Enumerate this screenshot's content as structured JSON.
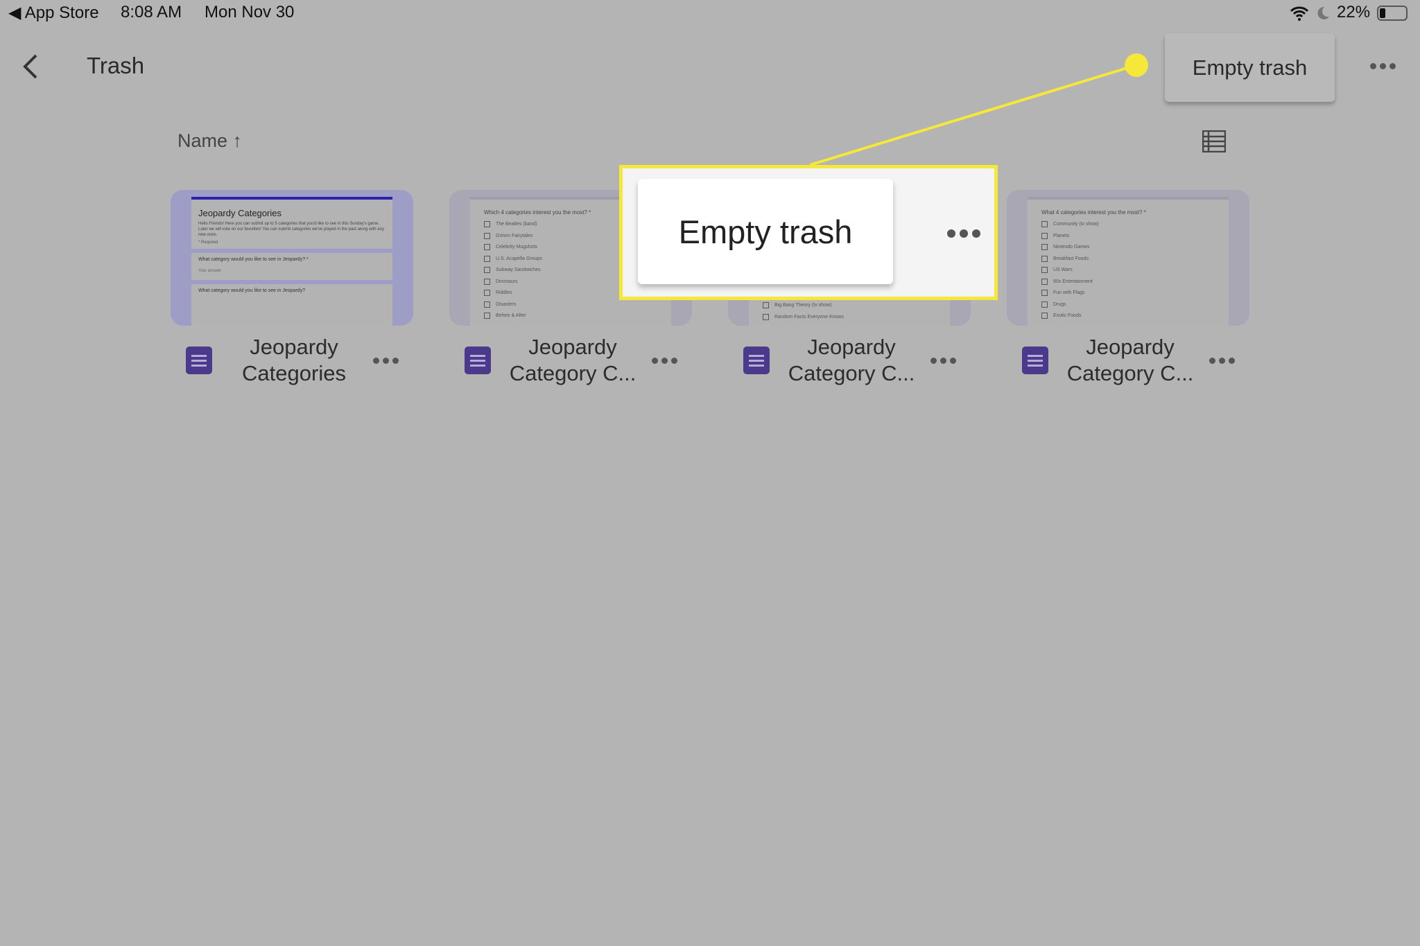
{
  "status_bar": {
    "back_app": "◀ App Store",
    "time": "8:08 AM",
    "date": "Mon Nov 30",
    "battery": "22%",
    "battery_level": 0.22
  },
  "header": {
    "title": "Trash",
    "menu_popover": "Empty trash"
  },
  "sort": {
    "label": "Name",
    "direction_icon": "↑"
  },
  "callout": {
    "label": "Empty trash",
    "highlight_color": "#f5e83a"
  },
  "files": [
    {
      "title_line1": "Jeopardy",
      "title_line2": "Categories",
      "preview": {
        "heading": "Jeopardy Categories",
        "body": "Hello Friends! Here you can submit up to 5 categories that you'd like to see in this Sunday's game. Later we will vote on our favorites! You can submit categories we've played in the past along with any new ones.",
        "required": "* Required",
        "q1": "What category would you like to see in Jeopardy? *",
        "answer_placeholder": "Your answer",
        "q2": "What category would you like to see in Jeopardy?"
      }
    },
    {
      "title_line1": "Jeopardy",
      "title_line2": "Category C...",
      "preview": {
        "question": "Which 4 categories interest you the most? *",
        "options": [
          "The Beatles (band)",
          "Grimm Fairytales",
          "Celebrity Mugshots",
          "U.S. Acapella Groups",
          "Subway Sandwiches",
          "Dinosaurs",
          "Riddles",
          "Disasters",
          "Before & After"
        ]
      }
    },
    {
      "title_line1": "Jeopardy",
      "title_line2": "Category C...",
      "preview": {
        "options": [
          "Big Bang Theory (tv show)",
          "Random Facts Everyone Knows"
        ]
      }
    },
    {
      "title_line1": "Jeopardy",
      "title_line2": "Category C...",
      "preview": {
        "question": "What 4 categories interest you the most? *",
        "options": [
          "Community (tv show)",
          "Planets",
          "Nintendo Games",
          "Breakfast Foods",
          "US Wars",
          "90s Entertainment",
          "Fun with Flags",
          "Drugs",
          "Exotic Foods"
        ]
      }
    }
  ]
}
